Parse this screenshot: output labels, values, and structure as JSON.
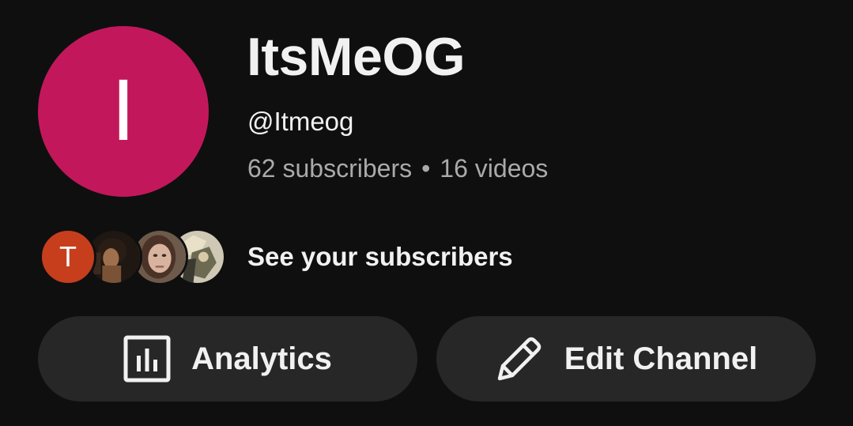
{
  "channel": {
    "avatar_letter": "I",
    "name": "ItsMeOG",
    "handle": "@Itmeog",
    "subscribers": "62 subscribers",
    "separator": "•",
    "videos": "16 videos"
  },
  "subscribers_row": {
    "first_initial": "T",
    "label": "See your subscribers"
  },
  "actions": {
    "analytics_label": "Analytics",
    "edit_label": "Edit Channel"
  },
  "icons": {
    "analytics": "bar-chart-icon",
    "edit": "pencil-icon"
  },
  "colors": {
    "background": "#0f0f0f",
    "avatar": "#c2185b",
    "subscriber_initial_avatar": "#c73e1d",
    "button": "#272727",
    "secondary_text": "#aaaaaa"
  }
}
